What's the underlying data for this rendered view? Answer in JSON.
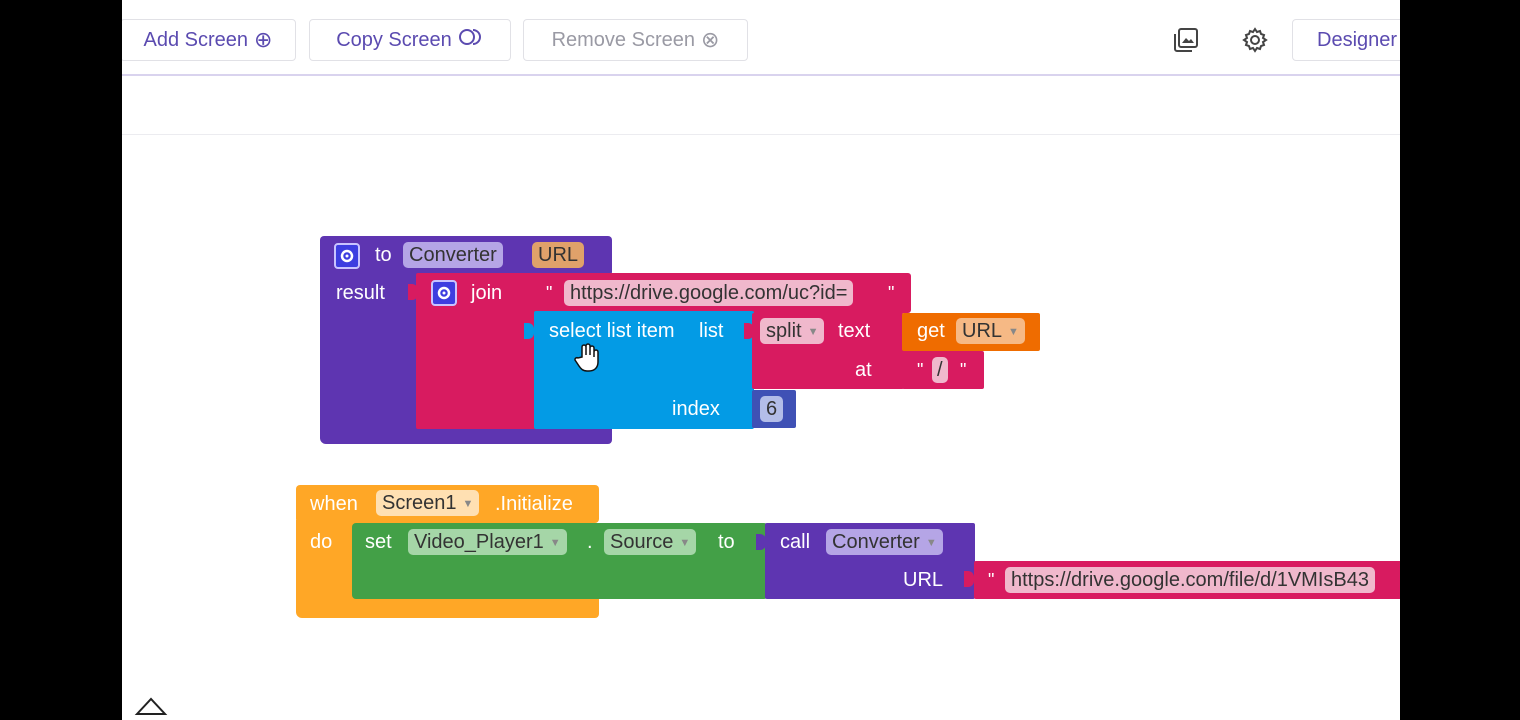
{
  "toolbar": {
    "add_screen": "Add Screen",
    "copy_screen": "Copy Screen",
    "remove_screen": "Remove Screen",
    "designer": "Designer"
  },
  "colors": {
    "procedure": "#5e35b1",
    "text": "#d81b60",
    "lists": "#039be5",
    "variable": "#ef6c00",
    "math": "#3f51b5",
    "event": "#ffa726",
    "component": "#43a047"
  },
  "procedure_block": {
    "to": "to",
    "name": "Converter",
    "param": "URL",
    "result": "result",
    "join": "join",
    "url_prefix": "https://drive.google.com/uc?id=",
    "select_list_item": "select list item",
    "list": "list",
    "index": "index",
    "split": "split",
    "text": "text",
    "get": "get",
    "get_var": "URL",
    "at": "at",
    "separator": "/",
    "index_value": "6"
  },
  "event_block": {
    "when": "when",
    "component": "Screen1",
    "event": ".Initialize",
    "do": "do",
    "set": "set",
    "target": "Video_Player1",
    "dot": ".",
    "property": "Source",
    "to": "to",
    "call": "call",
    "procedure": "Converter",
    "arg": "URL",
    "url_value": "https://drive.google.com/file/d/1VMIsB43"
  },
  "quote": "\""
}
